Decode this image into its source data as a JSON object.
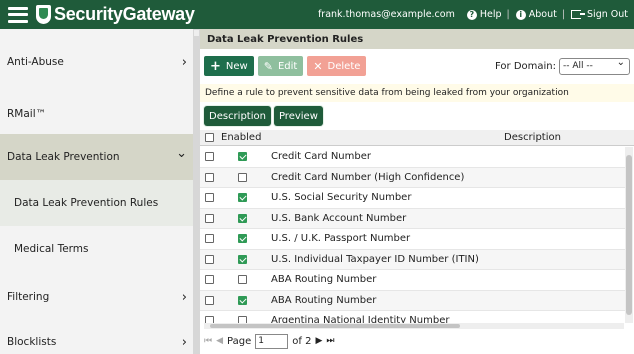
{
  "app": {
    "logo_text": "SecurityGateway",
    "user_email": "frank.thomas@example.com",
    "help_label": "Help",
    "about_label": "About",
    "signout_label": "Sign Out",
    "sep": "|"
  },
  "sidebar": {
    "items": [
      {
        "label": "Anti-Abuse",
        "chevron": "›"
      },
      {
        "label": "RMail™"
      },
      {
        "label": "Data Leak Prevention",
        "chevron": "⌄"
      },
      {
        "label": "Data Leak Prevention Rules"
      },
      {
        "label": "Medical Terms"
      },
      {
        "label": "Filtering",
        "chevron": "›"
      },
      {
        "label": "Blocklists",
        "chevron": "›"
      }
    ]
  },
  "main": {
    "title": "Data Leak Prevention Rules",
    "toolbar": {
      "new_label": "New",
      "edit_label": "Edit",
      "delete_label": "Delete",
      "domain_label": "For Domain:",
      "domain_value": "-- All --"
    },
    "info_text": "Define a rule to prevent sensitive data from being leaked from your organization",
    "tabs": [
      "Description",
      "Preview"
    ],
    "table": {
      "headers": {
        "enabled": "Enabled",
        "description": "Description"
      },
      "rows": [
        {
          "description": "Credit Card Number",
          "enabled": true
        },
        {
          "description": "Credit Card Number (High Confidence)",
          "enabled": false
        },
        {
          "description": "U.S. Social Security Number",
          "enabled": true
        },
        {
          "description": "U.S. Bank Account Number",
          "enabled": true
        },
        {
          "description": "U.S. / U.K. Passport Number",
          "enabled": true
        },
        {
          "description": "U.S. Individual Taxpayer ID Number (ITIN)",
          "enabled": true
        },
        {
          "description": "ABA Routing Number",
          "enabled": false
        },
        {
          "description": "ABA Routing Number",
          "enabled": true
        },
        {
          "description": "Argentina National Identity Number",
          "enabled": false
        }
      ]
    },
    "pager": {
      "page_label": "Page",
      "page_value": "1",
      "of_label": "of 2"
    }
  },
  "colors": {
    "brand_green": "#1f5b3a",
    "check_green": "#2f9a56",
    "header_gray": "#d5d6c8"
  }
}
